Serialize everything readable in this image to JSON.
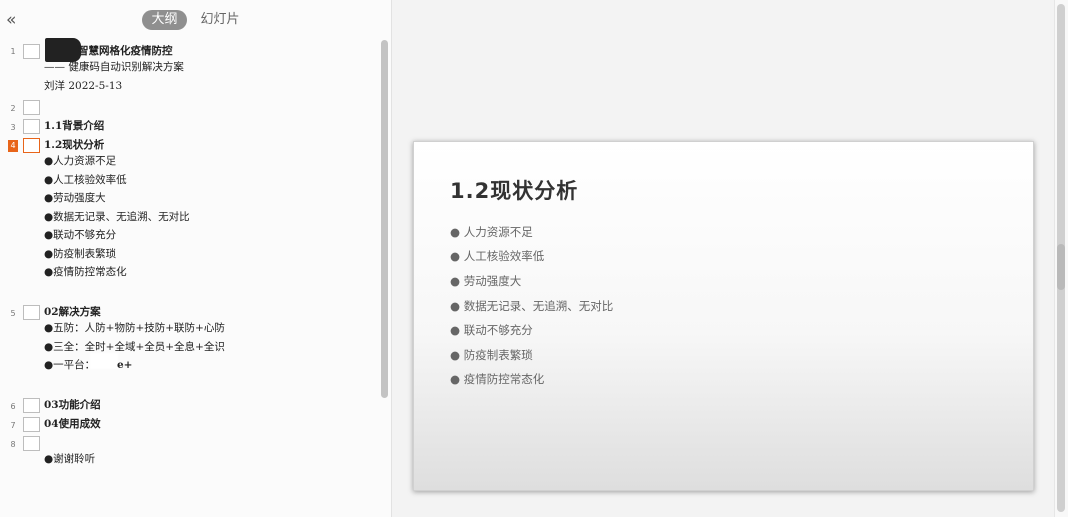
{
  "nav": {
    "collapse_glyph": "«",
    "tab_outline": "大纲",
    "tab_slides": "幻灯片"
  },
  "outline": {
    "s1": {
      "num": "1",
      "title_rest": "智慧网格化疫情防控",
      "subtitle": "—— 健康码自动识别解决方案",
      "author": "刘洋  2022-5-13"
    },
    "s2": {
      "num": "2"
    },
    "s3": {
      "num": "3",
      "title": "1.1背景介绍"
    },
    "s4": {
      "num": "4",
      "title": "1.2现状分析",
      "bullets": [
        "●人力资源不足",
        "●人工核验效率低",
        "●劳动强度大",
        "●数据无记录、无追溯、无对比",
        "●联动不够充分",
        "●防疫制表繁琐",
        "●疫情防控常态化"
      ]
    },
    "s5": {
      "num": "5",
      "title": "02解决方案",
      "bullets": [
        "●五防：人防+物防+技防+联防+心防",
        "●三全：全时+全域+全员+全息+全识",
        "●一平台："
      ],
      "bullet3_tail": "e+"
    },
    "s6": {
      "num": "6",
      "title": "03功能介绍"
    },
    "s7": {
      "num": "7",
      "title": "04使用成效"
    },
    "s8": {
      "num": "8",
      "bullet": "●谢谢聆听"
    }
  },
  "slide": {
    "title": "1.2现状分析",
    "bullets": [
      "● 人力资源不足",
      "● 人工核验效率低",
      "● 劳动强度大",
      "● 数据无记录、无追溯、无对比",
      "● 联动不够充分",
      "● 防疫制表繁琐",
      "● 疫情防控常态化"
    ]
  },
  "colors": {
    "accent": "#e8651a",
    "tab_active_bg": "#8f8f8f"
  }
}
